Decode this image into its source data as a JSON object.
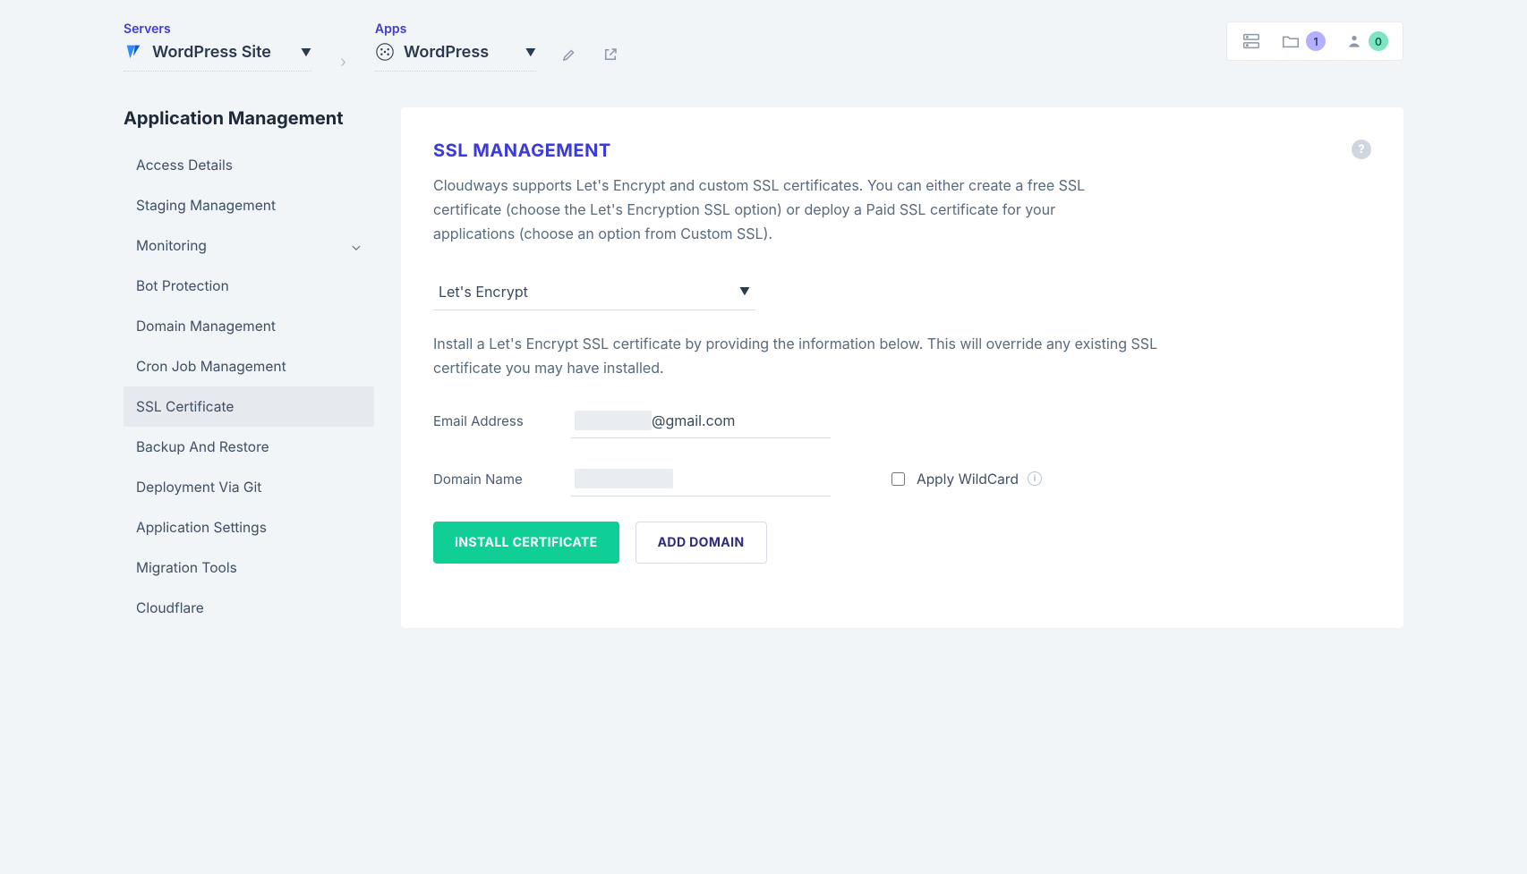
{
  "crumbs": {
    "servers_label": "Servers",
    "server_selected": "WordPress Site",
    "apps_label": "Apps",
    "app_selected": "WordPress"
  },
  "toolbar": {
    "projects_badge": "1",
    "user_badge": "0"
  },
  "sidebar": {
    "title": "Application Management",
    "items": [
      {
        "label": "Access Details",
        "active": false,
        "expandable": false
      },
      {
        "label": "Staging Management",
        "active": false,
        "expandable": false
      },
      {
        "label": "Monitoring",
        "active": false,
        "expandable": true
      },
      {
        "label": "Bot Protection",
        "active": false,
        "expandable": false
      },
      {
        "label": "Domain Management",
        "active": false,
        "expandable": false
      },
      {
        "label": "Cron Job Management",
        "active": false,
        "expandable": false
      },
      {
        "label": "SSL Certificate",
        "active": true,
        "expandable": false
      },
      {
        "label": "Backup And Restore",
        "active": false,
        "expandable": false
      },
      {
        "label": "Deployment Via Git",
        "active": false,
        "expandable": false
      },
      {
        "label": "Application Settings",
        "active": false,
        "expandable": false
      },
      {
        "label": "Migration Tools",
        "active": false,
        "expandable": false
      },
      {
        "label": "Cloudflare",
        "active": false,
        "expandable": false
      }
    ]
  },
  "panel": {
    "title": "SSL MANAGEMENT",
    "lede": "Cloudways supports Let's Encrypt and custom SSL certificates. You can either create a free SSL certificate (choose the Let's Encryption SSL option) or deploy a Paid SSL certificate for your applications (choose an option from Custom SSL).",
    "ssl_type_selected": "Let's Encrypt",
    "hint": "Install a Let's Encrypt SSL certificate by providing the information below. This will override any existing SSL certificate you may have installed.",
    "email_label": "Email Address",
    "email_value": "@gmail.com",
    "domain_label": "Domain Name",
    "domain_value": "",
    "wildcard_label": "Apply WildCard",
    "install_btn": "INSTALL CERTIFICATE",
    "add_domain_btn": "ADD DOMAIN"
  }
}
